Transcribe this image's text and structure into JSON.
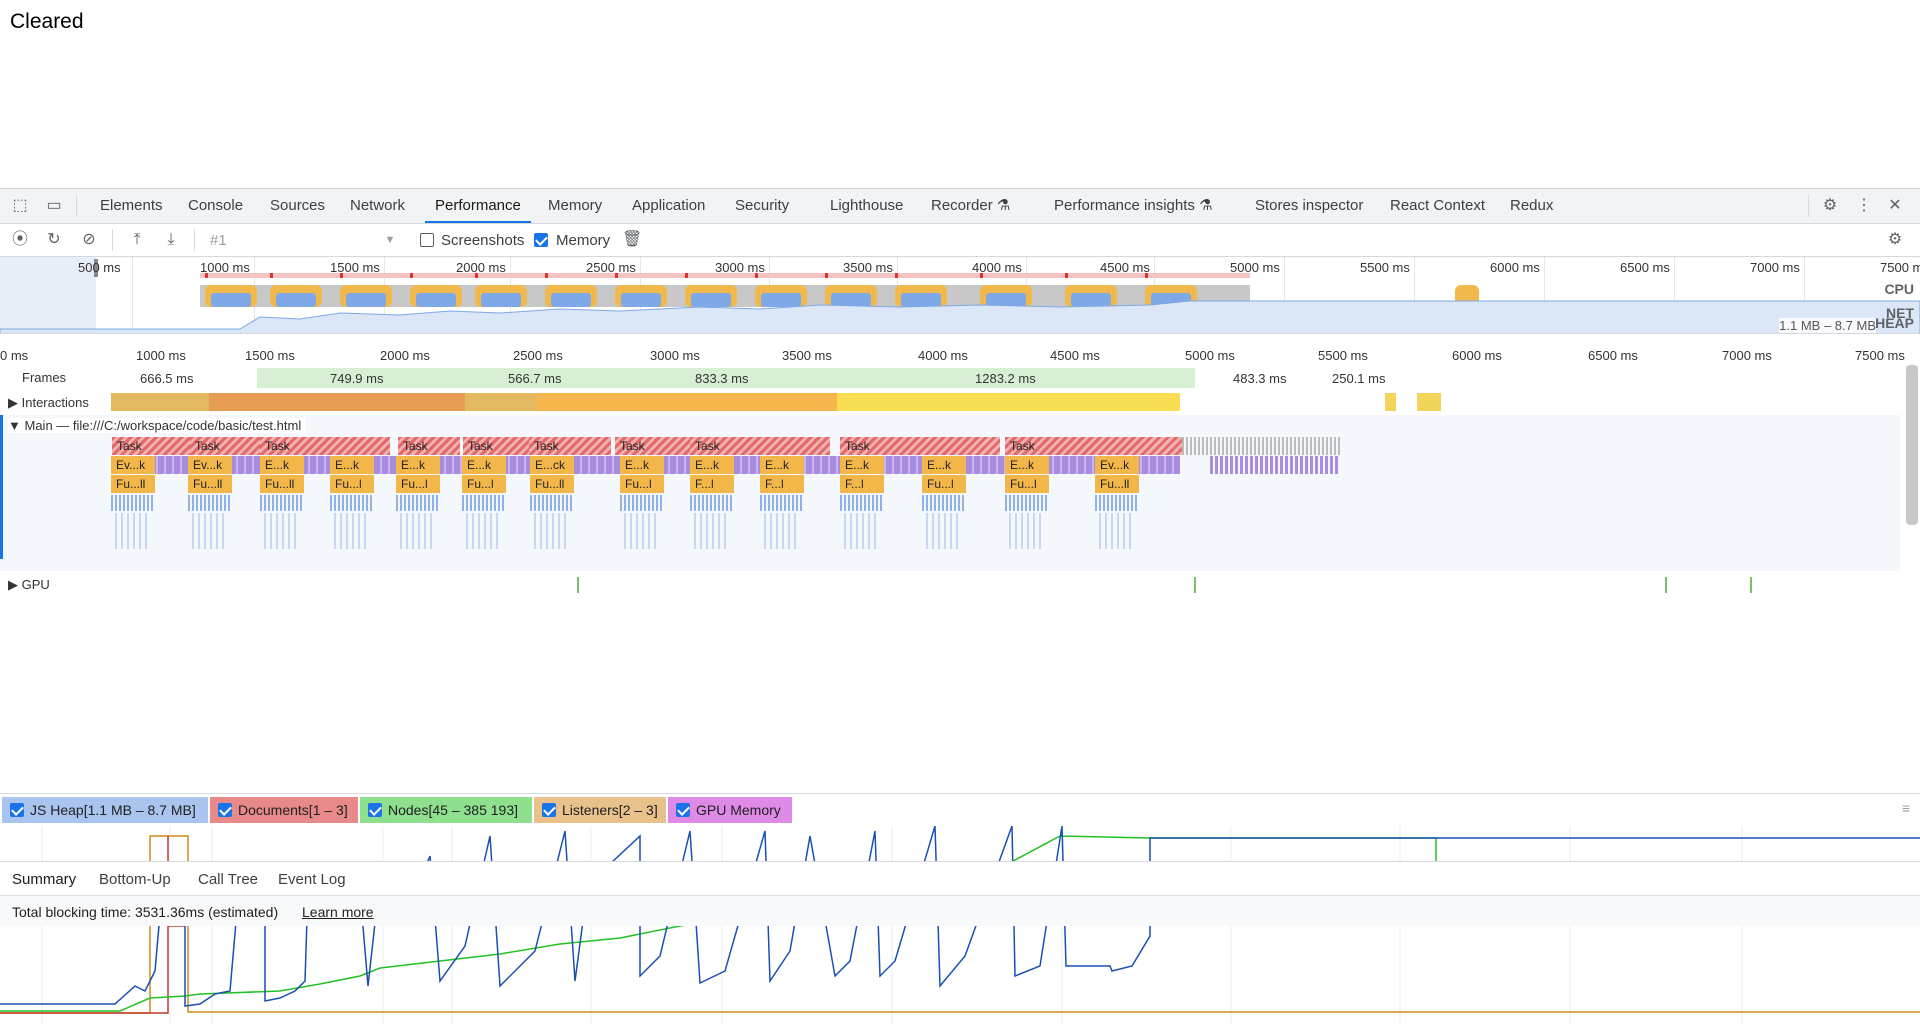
{
  "page": {
    "status_text": "Cleared"
  },
  "tabs": [
    "Elements",
    "Console",
    "Sources",
    "Network",
    "Performance",
    "Memory",
    "Application",
    "Security",
    "Lighthouse",
    "Recorder",
    "Performance insights",
    "Stores inspector",
    "React Context",
    "Redux"
  ],
  "toolbar": {
    "recording": "#1",
    "screenshots": "Screenshots",
    "memory": "Memory"
  },
  "overview_ticks": [
    "500 ms",
    "1000 ms",
    "1500 ms",
    "2000 ms",
    "2500 ms",
    "3000 ms",
    "3500 ms",
    "4000 ms",
    "4500 ms",
    "5000 ms",
    "5500 ms",
    "6000 ms",
    "6500 ms",
    "7000 ms",
    "7500 ms"
  ],
  "overview_labels": {
    "cpu": "CPU",
    "net": "NET",
    "heap": "HEAP",
    "heap_range": "1.1 MB – 8.7 MB"
  },
  "ruler_ticks": [
    "0 ms",
    "1000 ms",
    "1500 ms",
    "2000 ms",
    "2500 ms",
    "3000 ms",
    "3500 ms",
    "4000 ms",
    "4500 ms",
    "5000 ms",
    "5500 ms",
    "6000 ms",
    "6500 ms",
    "7000 ms",
    "7500 ms"
  ],
  "frames": {
    "label": "Frames",
    "values": [
      "666.5 ms",
      "749.9 ms",
      "566.7 ms",
      "833.3 ms",
      "1283.2 ms",
      "483.3 ms",
      "250.1 ms"
    ]
  },
  "tracks": {
    "interactions": "Interactions",
    "main": "Main — file:///C:/workspace/code/basic/test.html",
    "gpu": "GPU"
  },
  "flame": {
    "task": "Task",
    "events": [
      "Ev...k",
      "Ev...k",
      "E...k",
      "E...k",
      "E...k",
      "E...k",
      "E...ck",
      "E...k",
      "E...k",
      "E...k",
      "E...k",
      "E...k",
      "E...k",
      "Ev...k"
    ],
    "functions": [
      "Fu...ll",
      "Fu...ll",
      "Fu...ll",
      "Fu...l",
      "Fu...l",
      "Fu...l",
      "Fu...ll",
      "Fu...l",
      "F...l",
      "F...l",
      "F...l",
      "Fu...l",
      "Fu...l",
      "Fu...ll"
    ]
  },
  "memory_legend": [
    {
      "label": "JS Heap[1.1 MB – 8.7 MB]",
      "color": "#aac4f0"
    },
    {
      "label": "Documents[1 – 3]",
      "color": "#e88a8a"
    },
    {
      "label": "Nodes[45 – 385 193]",
      "color": "#8ee08e"
    },
    {
      "label": "Listeners[2 – 3]",
      "color": "#e8c28a"
    },
    {
      "label": "GPU Memory",
      "color": "#e08ae8"
    }
  ],
  "bottom_tabs": [
    "Summary",
    "Bottom-Up",
    "Call Tree",
    "Event Log"
  ],
  "status": {
    "text": "Total blocking time: 3531.36ms (estimated)",
    "link": "Learn more"
  }
}
